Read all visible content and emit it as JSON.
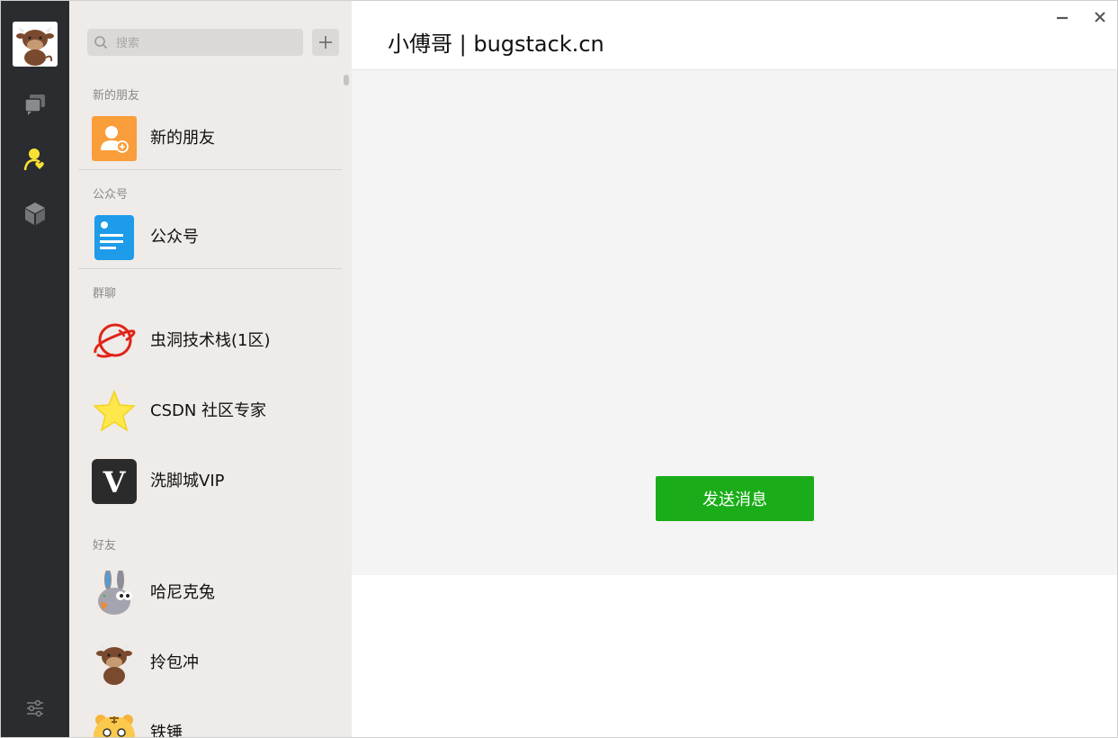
{
  "app": {
    "colors": {
      "nav_bg": "#2b2c30",
      "list_bg": "#eeebe8",
      "active_nav": "#f7e233",
      "send_button": "#1aad19",
      "content_bg": "#f4f4f4"
    }
  },
  "nav": {
    "avatar_icon": "cow-avatar",
    "items": [
      {
        "name": "chat",
        "icon": "chat-bubbles-icon",
        "active": false
      },
      {
        "name": "contacts",
        "icon": "contacts-icon",
        "active": true
      },
      {
        "name": "favorites",
        "icon": "cube-icon",
        "active": false
      }
    ],
    "settings_icon": "sliders-icon"
  },
  "search": {
    "placeholder": "搜索"
  },
  "sections": {
    "new_friends": "新的朋友",
    "public_accounts": "公众号",
    "groups": "群聊",
    "friends": "好友"
  },
  "items": {
    "new_friends": {
      "label": "新的朋友",
      "icon": "add-friend-icon"
    },
    "public_account": {
      "label": "公众号",
      "icon": "article-icon"
    },
    "group1": {
      "label": "虫洞技术栈(1区)",
      "icon": "planet-icon"
    },
    "group2": {
      "label": "CSDN 社区专家",
      "icon": "star-icon"
    },
    "group3": {
      "label": "洗脚城VIP",
      "icon": "v-logo"
    },
    "friend1": {
      "label": "哈尼克兔",
      "icon": "rabbit-avatar"
    },
    "friend2": {
      "label": "拎包冲",
      "icon": "cow-avatar"
    },
    "friend3": {
      "label": "铁锤",
      "icon": "tiger-avatar"
    }
  },
  "main": {
    "title": "小傅哥 | bugstack.cn",
    "send_label": "发送消息"
  }
}
